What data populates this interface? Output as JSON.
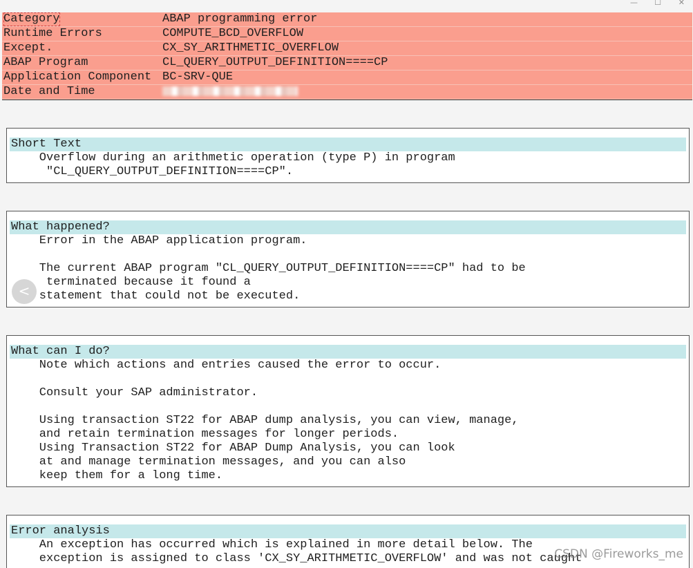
{
  "window_controls": {
    "minimize": "—",
    "maximize": "☐",
    "close": "✕"
  },
  "header": {
    "rows": [
      {
        "key": "Category",
        "value": "ABAP programming error"
      },
      {
        "key": "Runtime Errors",
        "value": "COMPUTE_BCD_OVERFLOW"
      },
      {
        "key": "Except.",
        "value": "CX_SY_ARITHMETIC_OVERFLOW"
      },
      {
        "key": "ABAP Program",
        "value": "CL_QUERY_OUTPUT_DEFINITION====CP"
      },
      {
        "key": "Application Component",
        "value": "BC-SRV-QUE"
      },
      {
        "key": "Date and Time",
        "value": ""
      }
    ]
  },
  "sections": {
    "short_text": {
      "title": "Short Text",
      "lines": [
        "    Overflow during an arithmetic operation (type P) in program",
        "     \"CL_QUERY_OUTPUT_DEFINITION====CP\"."
      ]
    },
    "what_happened": {
      "title": "What happened?",
      "lines": [
        "    Error in the ABAP application program.",
        "",
        "    The current ABAP program \"CL_QUERY_OUTPUT_DEFINITION====CP\" had to be",
        "     terminated because it found a",
        "    statement that could not be executed."
      ]
    },
    "what_can_i_do": {
      "title": "What can I do?",
      "lines": [
        "    Note which actions and entries caused the error to occur.",
        "",
        "    Consult your SAP administrator.",
        "",
        "    Using transaction ST22 for ABAP dump analysis, you can view, manage,",
        "    and retain termination messages for longer periods.",
        "    Using Transaction ST22 for ABAP Dump Analysis, you can look",
        "    at and manage termination messages, and you can also",
        "    keep them for a long time."
      ]
    },
    "error_analysis": {
      "title": "Error analysis",
      "lines": [
        "    An exception has occurred which is explained in more detail below. The",
        "    exception is assigned to class 'CX_SY_ARITHMETIC_OVERFLOW' and was not caught"
      ]
    }
  },
  "nav": {
    "back_glyph": "<"
  },
  "watermark": "CSDN @Fireworks_me"
}
